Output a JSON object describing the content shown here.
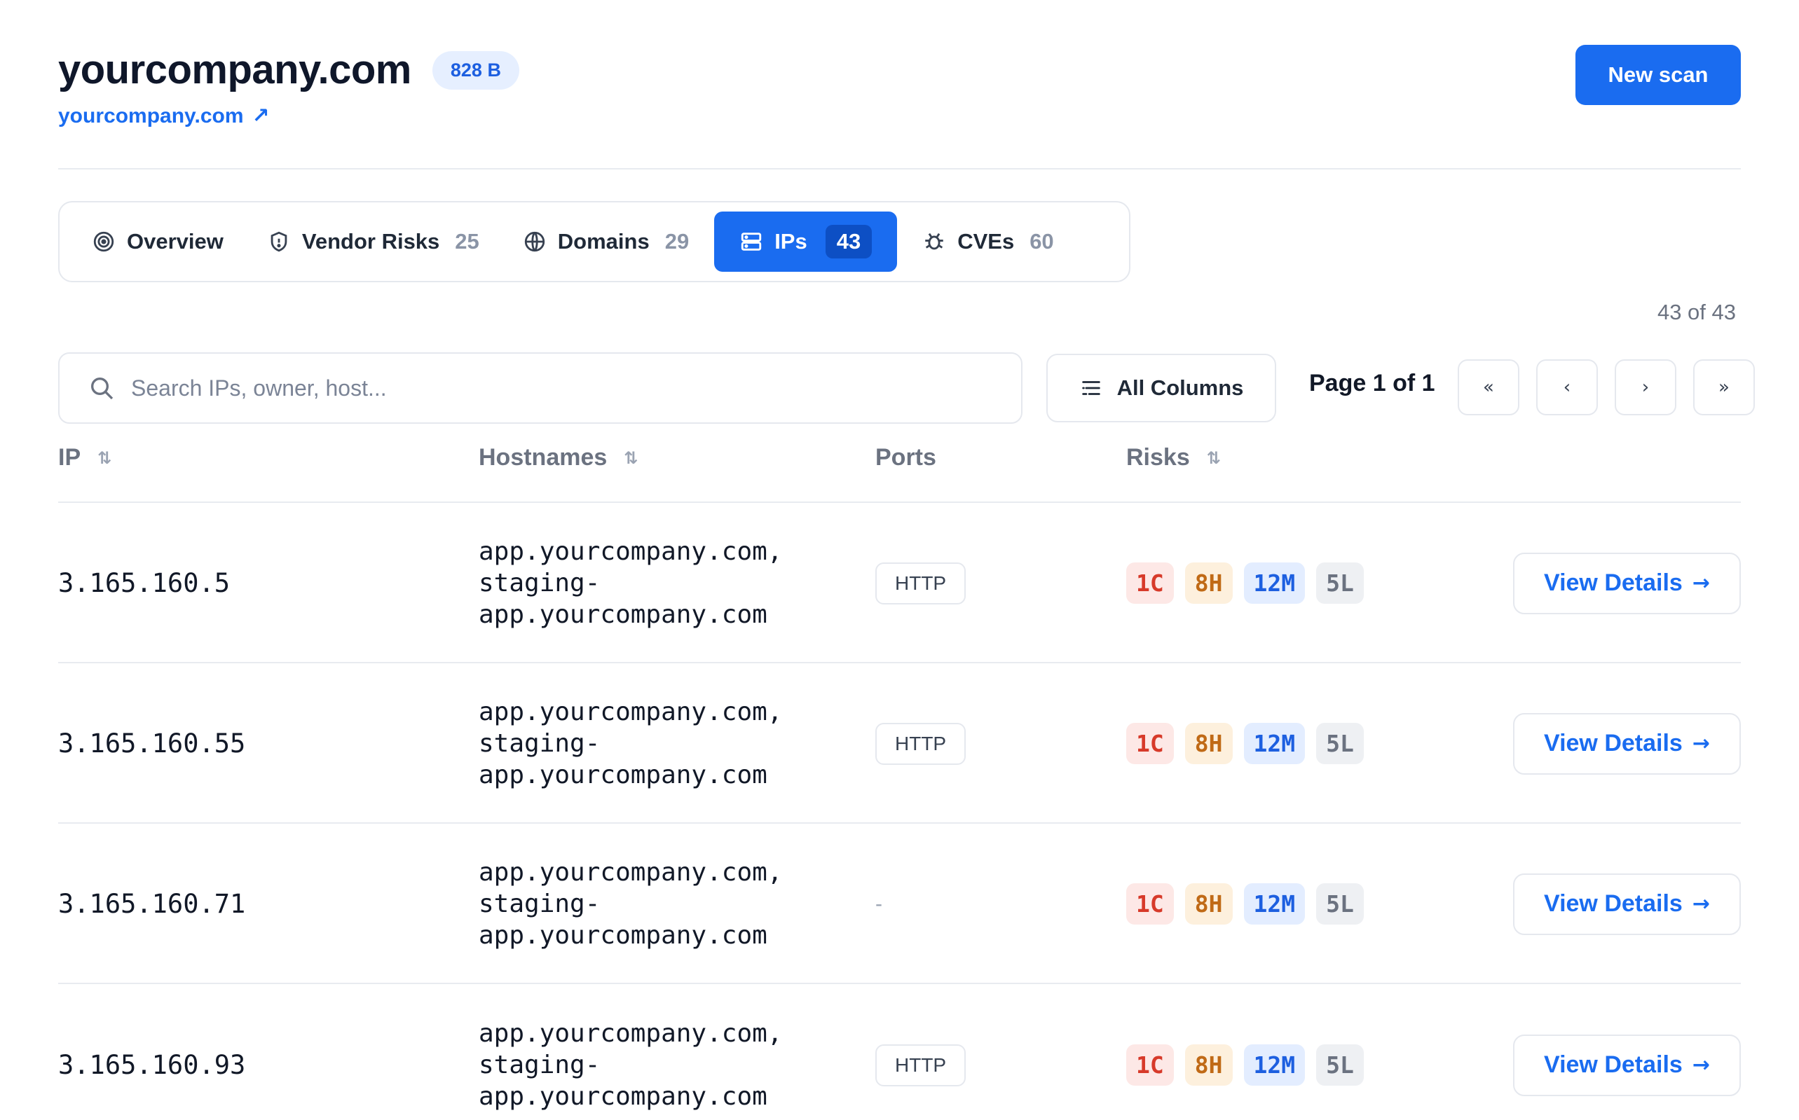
{
  "header": {
    "title": "yourcompany.com",
    "size_badge": "828 B",
    "link_text": "yourcompany.com",
    "link_icon": "external-link-arrow",
    "new_scan_label": "New scan"
  },
  "tabs": [
    {
      "label": "Overview",
      "count": "",
      "icon": "target-icon"
    },
    {
      "label": "Vendor Risks",
      "count": "25",
      "icon": "shield-icon"
    },
    {
      "label": "Domains",
      "count": "29",
      "icon": "globe-icon"
    },
    {
      "label": "IPs",
      "count": "43",
      "icon": "server-icon",
      "active": true
    },
    {
      "label": "CVEs",
      "count": "60",
      "icon": "bug-icon"
    }
  ],
  "result_count": "43 of 43",
  "toolbar": {
    "search_placeholder": "Search IPs, owner, host...",
    "columns_label": "All Columns",
    "page_label": "Page 1 of 1",
    "first_label": "«",
    "prev_label": "‹",
    "next_label": "›",
    "last_label": "»"
  },
  "table": {
    "columns": [
      "IP",
      "Hostnames",
      "Ports",
      "Risks"
    ],
    "rows": [
      {
        "ip": "3.165.160.5",
        "hosts": [
          "app.yourcompany.com,",
          "staging-",
          "app.yourcompany.com"
        ],
        "port": "HTTP",
        "risks": {
          "c": "1C",
          "h": "8H",
          "m": "12M",
          "l": "5L"
        },
        "action": "View Details"
      },
      {
        "ip": "3.165.160.55",
        "hosts": [
          "app.yourcompany.com,",
          "staging-",
          "app.yourcompany.com"
        ],
        "port": "HTTP",
        "risks": {
          "c": "1C",
          "h": "8H",
          "m": "12M",
          "l": "5L"
        },
        "action": "View Details"
      },
      {
        "ip": "3.165.160.71",
        "hosts": [
          "app.yourcompany.com,",
          "staging-",
          "app.yourcompany.com"
        ],
        "port": "-",
        "risks": {
          "c": "1C",
          "h": "8H",
          "m": "12M",
          "l": "5L"
        },
        "action": "View Details"
      },
      {
        "ip": "3.165.160.93",
        "hosts": [
          "app.yourcompany.com,",
          "staging-",
          "app.yourcompany.com"
        ],
        "port": "HTTP",
        "risks": {
          "c": "1C",
          "h": "8H",
          "m": "12M",
          "l": "5L"
        },
        "action": "View Details"
      }
    ]
  },
  "colors": {
    "accent": "#1a6cf0",
    "critical": "#d73a2a",
    "high": "#c06a16",
    "medium": "#1d5fe0",
    "low": "#6b7280"
  }
}
